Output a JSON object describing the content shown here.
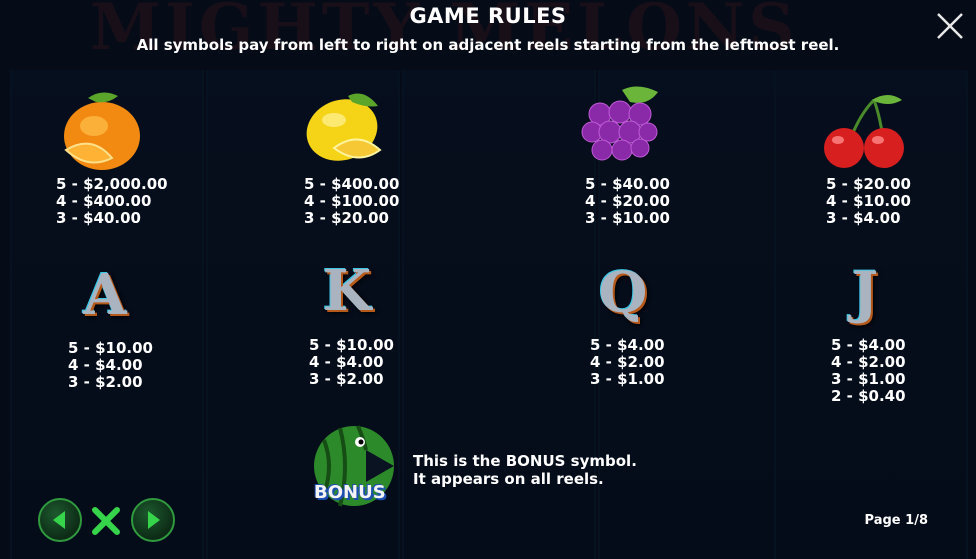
{
  "header": {
    "title": "GAME RULES",
    "subtitle": "All symbols pay from left to right on adjacent reels starting from the leftmost reel."
  },
  "symbols": [
    {
      "name": "orange",
      "payouts": [
        "5 - $2,000.00",
        "4 - $400.00",
        "3 - $40.00"
      ]
    },
    {
      "name": "lemon",
      "payouts": [
        "5 - $400.00",
        "4 - $100.00",
        "3 - $20.00"
      ]
    },
    {
      "name": "grapes",
      "payouts": [
        "5 - $40.00",
        "4 - $20.00",
        "3 - $10.00"
      ]
    },
    {
      "name": "cherries",
      "payouts": [
        "5 - $20.00",
        "4 - $10.00",
        "3 - $4.00"
      ]
    },
    {
      "name": "A",
      "payouts": [
        "5 - $10.00",
        "4 - $4.00",
        "3 - $2.00"
      ]
    },
    {
      "name": "K",
      "payouts": [
        "5 - $10.00",
        "4 - $4.00",
        "3 - $2.00"
      ]
    },
    {
      "name": "Q",
      "payouts": [
        "5 - $4.00",
        "4 - $2.00",
        "3 - $1.00"
      ]
    },
    {
      "name": "J",
      "payouts": [
        "5 - $4.00",
        "4 - $2.00",
        "3 - $1.00",
        "2 - $0.40"
      ]
    }
  ],
  "bonus": {
    "icon_label": "BONUS",
    "line1": "This is the BONUS symbol.",
    "line2": "It appears on all reels."
  },
  "footer": {
    "page_indicator": "Page 1/8"
  },
  "icons": {
    "close": "close-icon",
    "prev": "arrow-left-icon",
    "exit": "x-icon",
    "next": "arrow-right-icon"
  },
  "colors": {
    "background": "#0a1322",
    "nav_green": "#35d44a",
    "text": "#ffffff"
  }
}
